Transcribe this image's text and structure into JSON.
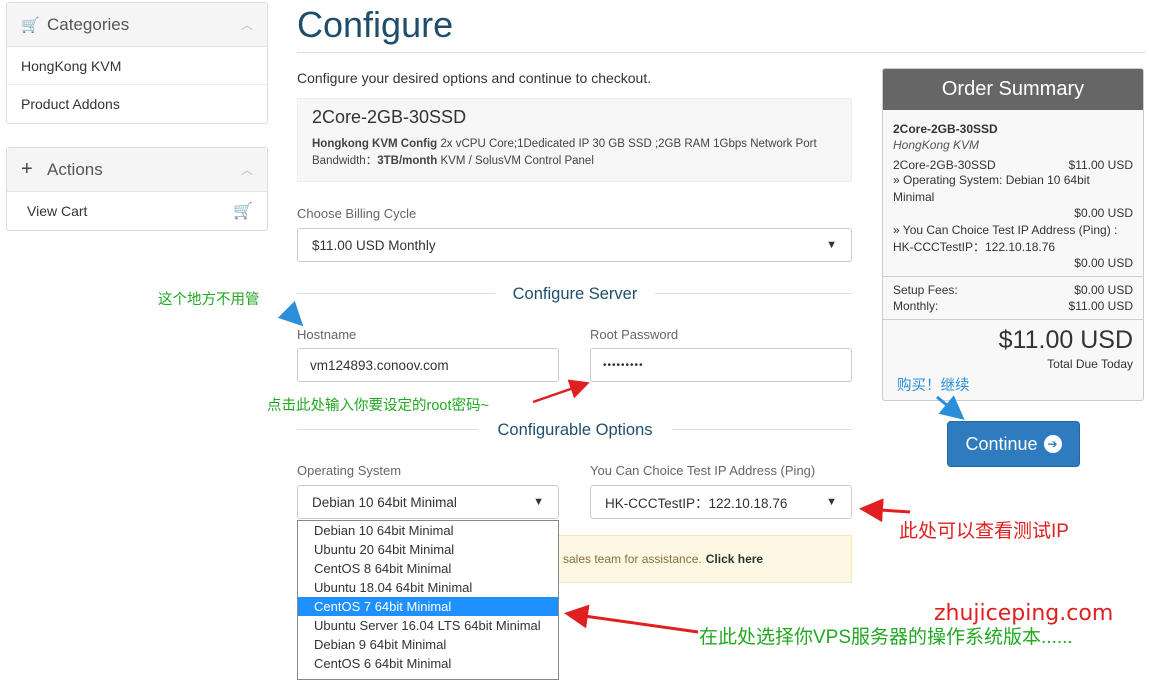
{
  "sidebar": {
    "categories": {
      "title": "Categories",
      "items": [
        "HongKong KVM",
        "Product Addons"
      ]
    },
    "actions": {
      "title": "Actions",
      "items": [
        "View Cart"
      ]
    }
  },
  "main": {
    "title": "Configure",
    "intro": "Configure your desired options and continue to checkout.",
    "product": {
      "name": "2Core-2GB-30SSD",
      "config_label": "Hongkong KVM Config",
      "config_text": "2x vCPU Core;1Dedicated IP 30 GB SSD ;2GB RAM 1Gbps Network Port",
      "bandwidth_label": "Bandwidth：",
      "bandwidth_value": "3TB/month",
      "bandwidth_rest": "KVM / SolusVM Control Panel"
    },
    "billing": {
      "label": "Choose Billing Cycle",
      "value": "$11.00 USD Monthly"
    },
    "configure_server": {
      "heading": "Configure Server",
      "hostname_label": "Hostname",
      "hostname_value": "vm124893.conoov.com",
      "password_label": "Root Password",
      "password_value": "•••••••••"
    },
    "configurable_options": {
      "heading": "Configurable Options",
      "os_label": "Operating System",
      "os_value": "Debian 10 64bit Minimal",
      "ip_label": "You Can Choice Test IP Address (Ping)",
      "ip_value": "HK-CCCTestIP：122.10.18.76"
    },
    "os_options": [
      "Debian 10 64bit Minimal",
      "Ubuntu 20 64bit Minimal",
      "CentOS 8 64bit Minimal",
      "Ubuntu 18.04 64bit Minimal",
      "CentOS 7 64bit Minimal",
      "Ubuntu Server 16.04 LTS 64bit Minimal",
      "Debian 9 64bit Minimal",
      "CentOS 6 64bit Minimal"
    ],
    "os_selected_index": 4,
    "alert": {
      "text": "sales team for assistance.",
      "link": "Click here"
    }
  },
  "summary": {
    "title": "Order Summary",
    "product": "2Core-2GB-30SSD",
    "group": "HongKong KVM",
    "line_name": "2Core-2GB-30SSD",
    "line_price": "$11.00 USD",
    "os_line": "» Operating System: Debian 10 64bit Minimal",
    "os_price": "$0.00 USD",
    "ip_line": "» You Can Choice Test IP Address (Ping) : HK-CCCTestIP：122.10.18.76",
    "ip_price": "$0.00 USD",
    "setup_label": "Setup Fees:",
    "setup_value": "$0.00 USD",
    "monthly_label": "Monthly:",
    "monthly_value": "$11.00 USD",
    "total": "$11.00 USD",
    "total_label": "Total Due Today",
    "continue_label": "Continue"
  },
  "annotations": {
    "ignore_here": "这个地方不用管",
    "root_password": "点击此处输入你要设定的root密码~",
    "buy_continue": "购买！继续",
    "test_ip": "此处可以查看测试IP",
    "choose_os": "在此处选择你VPS服务器的操作系统版本......",
    "watermark": "zhujiceping.com"
  },
  "colors": {
    "title": "#1f4e6d",
    "button": "#2f7bbf",
    "annotation_green": "#22a822",
    "annotation_red": "#e02020"
  }
}
